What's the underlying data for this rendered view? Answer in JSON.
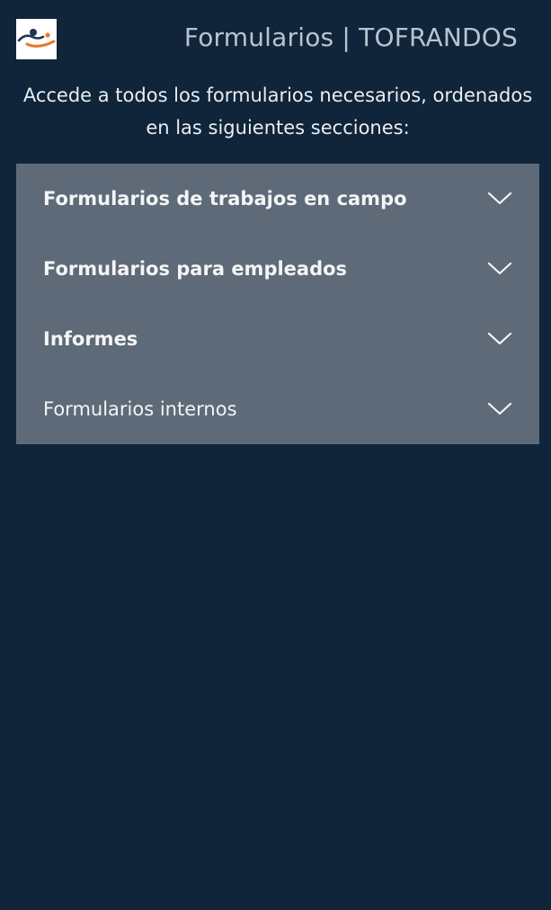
{
  "header": {
    "logo_icon": "tofrandos-logo-icon",
    "title": "Formularios | TOFRANDOS"
  },
  "intro": {
    "text": "Accede a todos los formularios necesarios, ordenados en las siguientes secciones:"
  },
  "accordion": {
    "items": [
      {
        "label": "Formularios de trabajos en campo",
        "bold": true,
        "icon": "chevron-down-icon"
      },
      {
        "label": "Formularios para empleados",
        "bold": true,
        "icon": "chevron-down-icon"
      },
      {
        "label": "Informes",
        "bold": true,
        "icon": "chevron-down-icon"
      },
      {
        "label": "Formularios internos",
        "bold": false,
        "icon": "chevron-down-icon"
      }
    ]
  },
  "colors": {
    "background": "#10243a",
    "accordion_bg": "#5e6a77",
    "title_text": "#b9c4cf",
    "logo_navy": "#1d3551",
    "logo_orange": "#e9782a"
  }
}
